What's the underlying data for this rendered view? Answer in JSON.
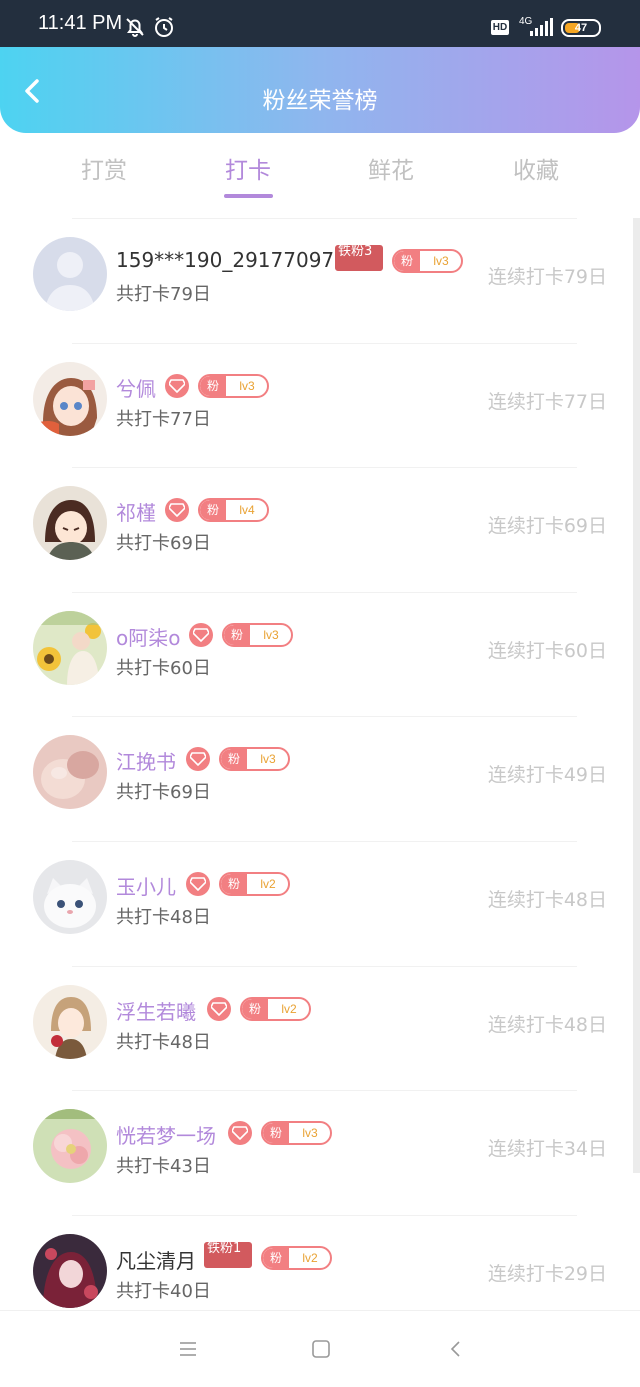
{
  "status_bar": {
    "time": "11:41 PM",
    "hd": "HD",
    "network": "4G",
    "battery": "47",
    "battery_level": 0.47
  },
  "header": {
    "title": "粉丝荣誉榜"
  },
  "tabs": [
    {
      "label": "打赏",
      "active": false
    },
    {
      "label": "打卡",
      "active": true
    },
    {
      "label": "鲜花",
      "active": false
    },
    {
      "label": "收藏",
      "active": false
    }
  ],
  "users": [
    {
      "name": "159***190_291770970",
      "total": "共打卡79日",
      "streak": "连续打卡79日",
      "badge": "iron",
      "iron_text": "铁粉3",
      "fan_label": "粉",
      "level": "lv3",
      "avatar": "default-avatar"
    },
    {
      "name": "兮佩",
      "total": "共打卡77日",
      "streak": "连续打卡77日",
      "badge": "heart",
      "fan_label": "粉",
      "level": "lv3",
      "avatar": "anime-girl-avatar"
    },
    {
      "name": "祁槿",
      "total": "共打卡69日",
      "streak": "连续打卡69日",
      "badge": "heart",
      "fan_label": "粉",
      "level": "lv4",
      "avatar": "anime-boy-avatar"
    },
    {
      "name": "o阿柒o",
      "total": "共打卡60日",
      "streak": "连续打卡60日",
      "badge": "heart",
      "fan_label": "粉",
      "level": "lv3",
      "avatar": "sunflower-avatar"
    },
    {
      "name": "江挽书",
      "total": "共打卡69日",
      "streak": "连续打卡49日",
      "badge": "heart",
      "fan_label": "粉",
      "level": "lv3",
      "avatar": "pink-photo-avatar"
    },
    {
      "name": "玉小儿",
      "total": "共打卡48日",
      "streak": "连续打卡48日",
      "badge": "heart",
      "fan_label": "粉",
      "level": "lv2",
      "avatar": "kitten-avatar"
    },
    {
      "name": "浮生若曦",
      "total": "共打卡48日",
      "streak": "连续打卡48日",
      "badge": "heart",
      "fan_label": "粉",
      "level": "lv2",
      "avatar": "anime-rose-avatar"
    },
    {
      "name": "恍若梦一场",
      "total": "共打卡43日",
      "streak": "连续打卡34日",
      "badge": "heart",
      "fan_label": "粉",
      "level": "lv3",
      "avatar": "flower-avatar"
    },
    {
      "name": "凡尘清月",
      "total": "共打卡40日",
      "streak": "连续打卡29日",
      "badge": "iron",
      "iron_text": "铁粉1",
      "fan_label": "粉",
      "level": "lv2",
      "avatar": "anime-dark-avatar"
    }
  ],
  "colors": {
    "accent": "#b289db",
    "badge_pink": "#f27f82",
    "iron_red": "#d25a5e",
    "level_orange": "#e9a233",
    "status_bar": "#232f3e"
  }
}
